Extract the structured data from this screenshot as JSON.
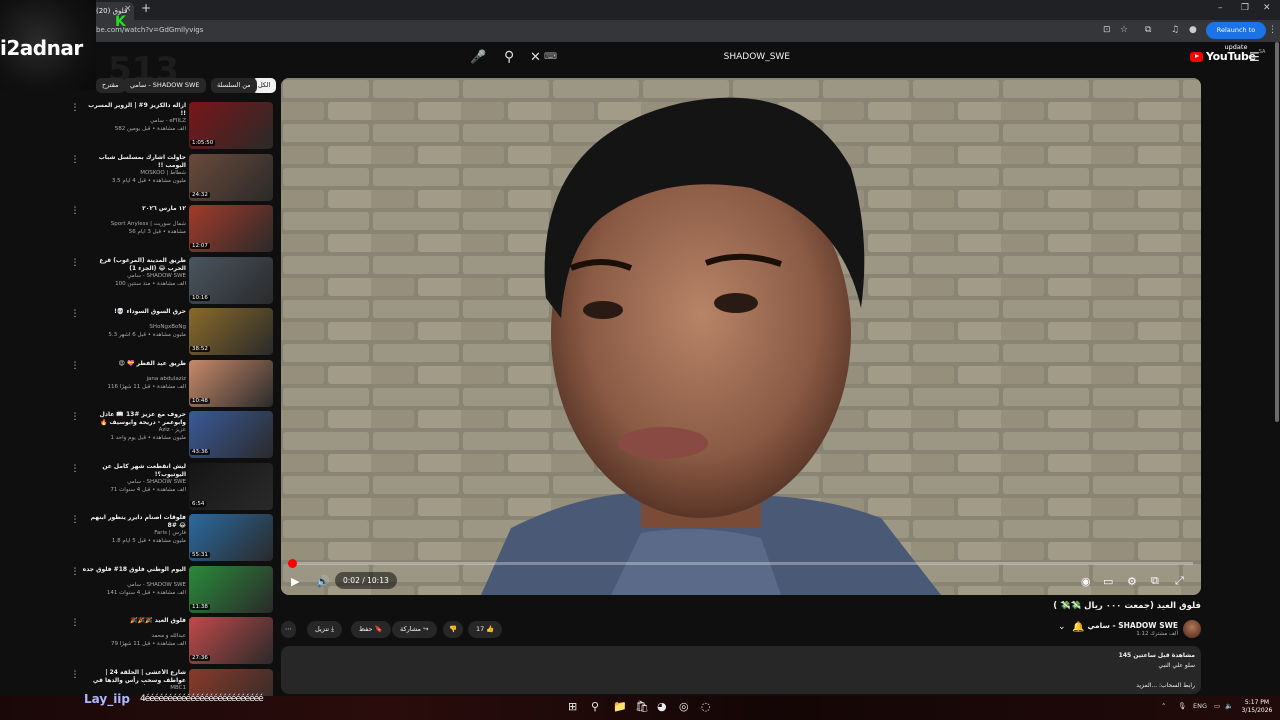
{
  "browser": {
    "tab_title": "(20) قلوق",
    "url": "be.com/watch?v=GdGmllyvigs",
    "relaunch_label": "Relaunch to update"
  },
  "overlay": {
    "streamer_logo": "i2adnar",
    "ghost_count": "513",
    "chat_user": "Lay_iip",
    "chat_message": "4éééééééééééééééééééééééééé"
  },
  "youtube": {
    "search_query": "SHADOW_SWE",
    "logo_text": "YouTube",
    "logo_region": "SA",
    "chips": [
      {
        "label": "الكل"
      },
      {
        "label": "من السلسلة"
      },
      {
        "label": "سامي - SHADOW SWE"
      },
      {
        "label": "مقترح"
      }
    ],
    "recommendations": [
      {
        "title": "ازاله دالكزيز 9# | الزوير المسرب !!",
        "channel": "سامي - eFIILZ",
        "meta": "582 ألف مشاهدة • قبل يومين",
        "duration": "1:05:50",
        "thumb": "#7a1518"
      },
      {
        "title": "حاولت اشارك بمسلسل شباب البومب !!",
        "channel": "MOSKOO | شطاط",
        "meta": "3.5 مليون مشاهدة • قبل 4 أيام",
        "duration": "24:32",
        "thumb": "#6a4a3a"
      },
      {
        "title": "١٢ مارس ٢٠٢٦",
        "channel": "Sport Anyless | شمال سوريت",
        "meta": "56 مشاهدة • قبل 3 أيام",
        "duration": "12:07",
        "thumb": "#a33a2a"
      },
      {
        "title": "طريق المدينة (المرغوب) قرع الحرب 😂 (الجزء 1)",
        "channel": "سامي - SHADOW SWE",
        "meta": "100 ألف مشاهدة • منذ سنتين",
        "duration": "10:16",
        "thumb": "#4a5560"
      },
      {
        "title": "حرق السوق السوداء 💀!",
        "channel": "SHoNgxBoNg",
        "meta": "5.3 مليون مشاهدة • قبل 6 أشهر",
        "duration": "38:52",
        "thumb": "#8a6a2a"
      },
      {
        "title": "طريق عيد الفطر 💝 😍",
        "channel": "jana abdulaziz",
        "meta": "116 ألف مشاهدة • قبل 11 شهرًا",
        "duration": "10:48",
        "thumb": "#c88a6a"
      },
      {
        "title": "حروف مع عزيز #13 📖 عادل وابوعمر - دريحة وابوسيف 🔥 الموسم الثالث",
        "channel": "Aziz - عزيز",
        "meta": "1 مليون مشاهدة • قبل يوم واحد",
        "duration": "43:36",
        "thumb": "#3a5a9a"
      },
      {
        "title": "ليش انقطعت شهر كامل عن اليوتيوب؟!",
        "channel": "سامي - SHADOW SWE",
        "meta": "71 ألف مشاهدة • قبل 4 سنوات",
        "duration": "6:54",
        "thumb": "#151515"
      },
      {
        "title": "فلوقات اصنام دايرر يتطور ابنهم 😂 #8",
        "channel": "Faris | فارس",
        "meta": "1.8 مليون مشاهدة • قبل 5 أيام",
        "duration": "55:31",
        "thumb": "#2a6aa0"
      },
      {
        "title": "اليوم الوطني فلوق 18# فلوق جده",
        "channel": "سامي - SHADOW SWE",
        "meta": "141 ألف مشاهدة • قبل 4 سنوات",
        "duration": "11:38",
        "thumb": "#2a8a3a"
      },
      {
        "title": "فلوق العيد 🎉🎉🎉",
        "channel": "عبدالله و محمد",
        "meta": "79 ألف مشاهدة • قبل 11 شهرًا",
        "duration": "27:36",
        "thumb": "#c04a4a"
      },
      {
        "title": "شارع الأعشى | الحلقة 24 | عواطف وسحب رأس والدها في إبراهيم في الأرض ورفضت",
        "channel": "MBC1",
        "meta": "",
        "duration": "",
        "thumb": "#8a3a2a"
      }
    ]
  },
  "player": {
    "time": "0:02 / 10:13",
    "progress": 0.0033
  },
  "video": {
    "title": "فلوق العيد (جمعت ٠٠٠ ريال 💸💸 )",
    "channel_name": "سامي - SHADOW SWE",
    "subscribers": "1.12 ألف مشترك",
    "likes": "17",
    "share_label": "مشاركة",
    "save_label": "حفظ",
    "download_label": "تنزيل",
    "desc_line1": "145 مشاهدة قبل ساعتين",
    "desc_line2": "سلو علي النبي",
    "desc_line3": "رابط السحاب: ...المزيد"
  },
  "taskbar": {
    "lang": "ENG",
    "time": "5:17 PM",
    "date": "3/15/2026"
  }
}
